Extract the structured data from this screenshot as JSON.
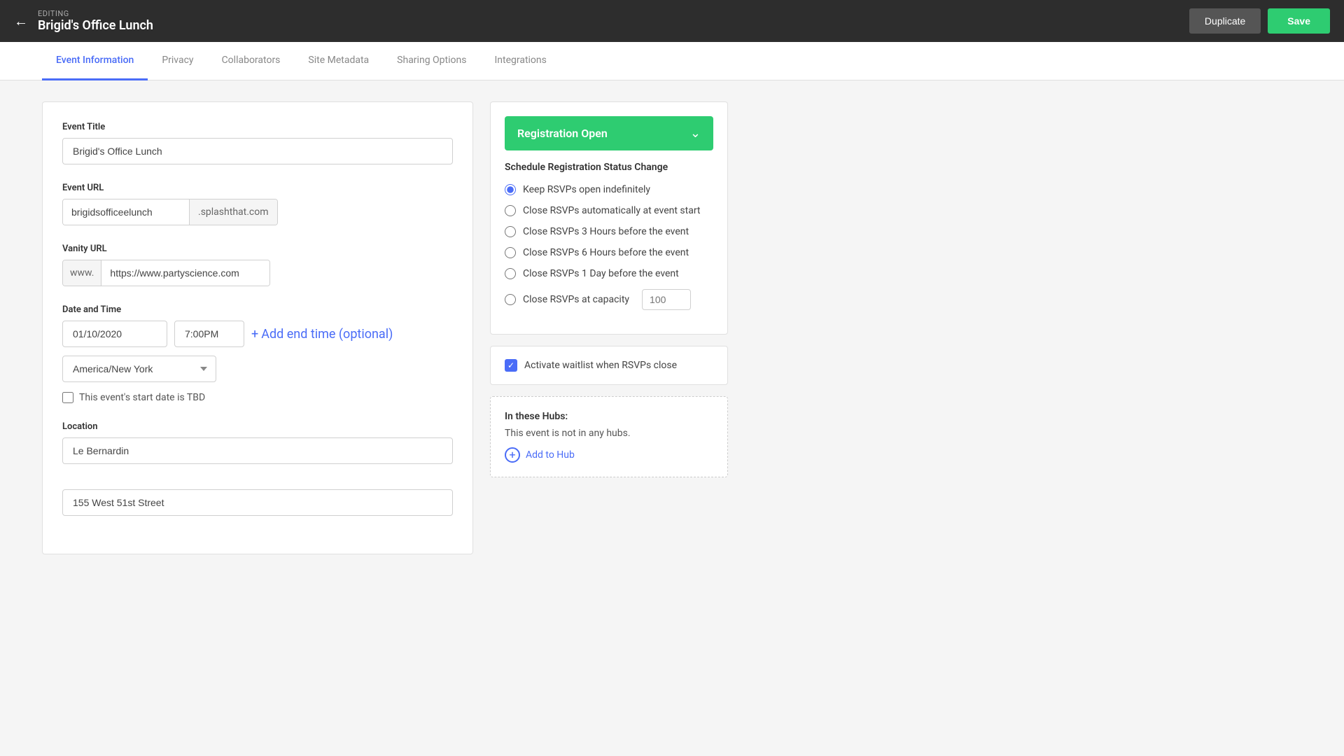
{
  "header": {
    "editing_label": "EDITING",
    "event_name": "Brigid's Office Lunch",
    "duplicate_label": "Duplicate",
    "save_label": "Save"
  },
  "tabs": [
    {
      "id": "event-information",
      "label": "Event Information",
      "active": true
    },
    {
      "id": "privacy",
      "label": "Privacy",
      "active": false
    },
    {
      "id": "collaborators",
      "label": "Collaborators",
      "active": false
    },
    {
      "id": "site-metadata",
      "label": "Site Metadata",
      "active": false
    },
    {
      "id": "sharing-options",
      "label": "Sharing Options",
      "active": false
    },
    {
      "id": "integrations",
      "label": "Integrations",
      "active": false
    }
  ],
  "left_panel": {
    "event_title_label": "Event Title",
    "event_title_value": "Brigid's Office Lunch",
    "event_url_label": "Event URL",
    "event_url_value": "brigidsofficeelunch",
    "event_url_suffix": ".splashthat.com",
    "vanity_url_label": "Vanity URL",
    "vanity_prefix": "www.",
    "vanity_url_value": "https://www.partyscience.com",
    "date_time_label": "Date and Time",
    "date_value": "01/10/2020",
    "time_value": "7:00PM",
    "add_end_time_label": "Add end time (optional)",
    "timezone_value": "America/New York",
    "tbd_label": "This event's start date is TBD",
    "location_label": "Location",
    "location_value": "Le Bernardin",
    "address_value": "155 West 51st Street"
  },
  "right_panel": {
    "registration_status": "Registration Open",
    "schedule_title": "Schedule Registration Status Change",
    "radio_options": [
      {
        "id": "opt1",
        "label": "Keep RSVPs open indefinitely",
        "checked": true
      },
      {
        "id": "opt2",
        "label": "Close RSVPs automatically at event start",
        "checked": false
      },
      {
        "id": "opt3",
        "label": "Close RSVPs 3 Hours before the event",
        "checked": false
      },
      {
        "id": "opt4",
        "label": "Close RSVPs 6 Hours before the event",
        "checked": false
      },
      {
        "id": "opt5",
        "label": "Close RSVPs 1 Day before the event",
        "checked": false
      },
      {
        "id": "opt6",
        "label": "Close RSVPs at capacity",
        "checked": false
      }
    ],
    "capacity_placeholder": "100",
    "waitlist_label": "Activate waitlist when RSVPs close",
    "hubs_title": "In these Hubs:",
    "hubs_desc": "This event is not in any hubs.",
    "add_to_hub_label": "Add to Hub"
  }
}
